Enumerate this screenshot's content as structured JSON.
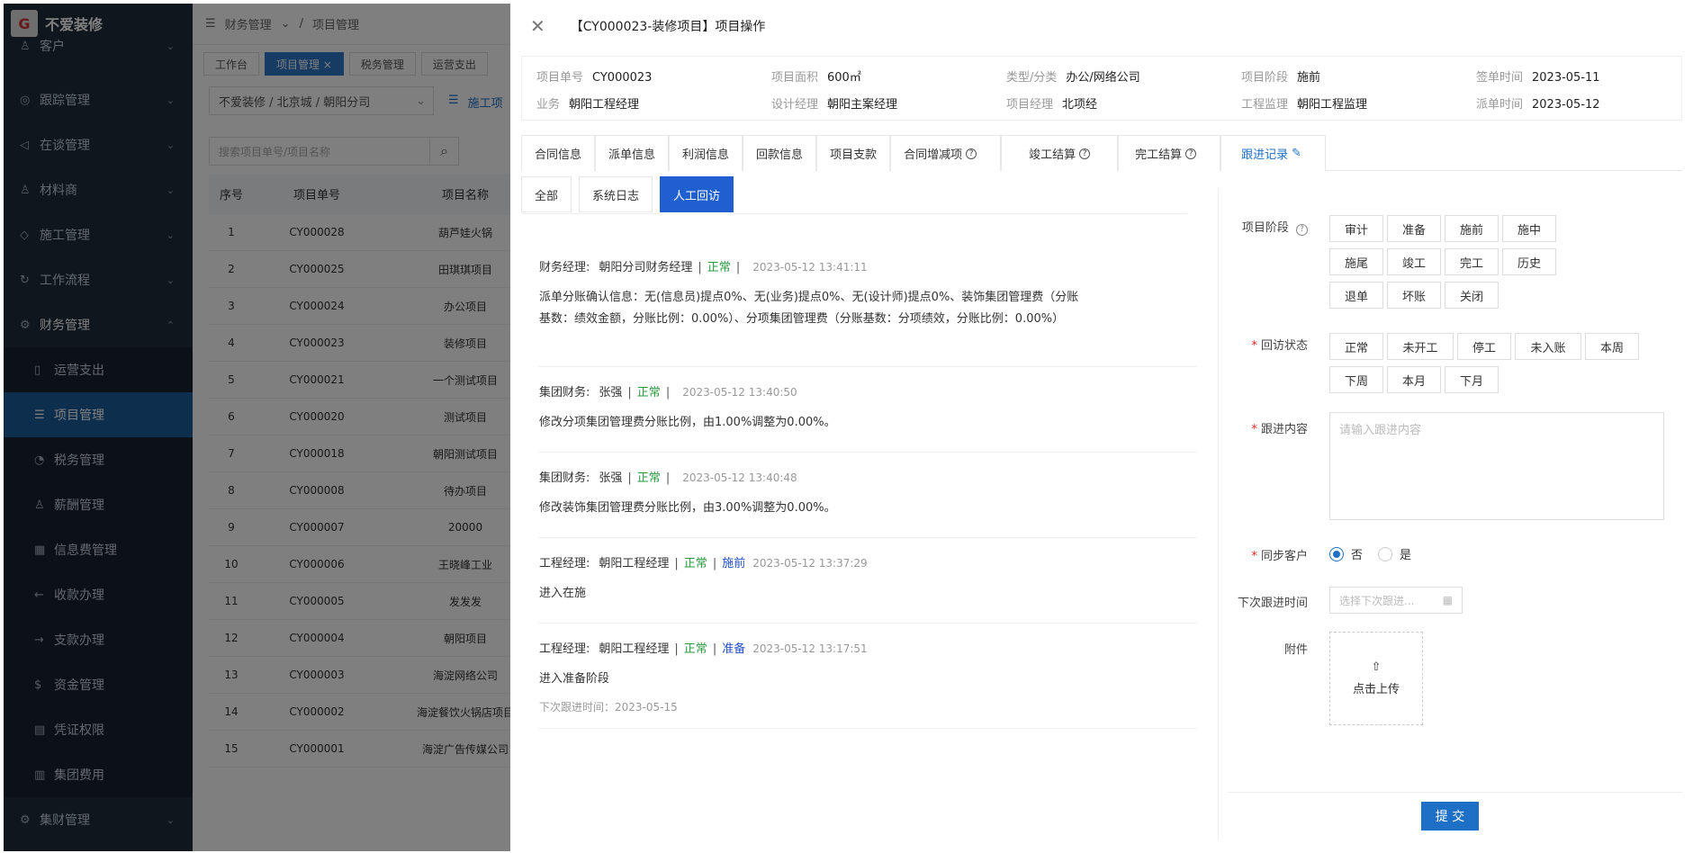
{
  "app": {
    "name": "不爱装修",
    "logo_text": "G"
  },
  "sidebar": {
    "items": [
      {
        "label": "客户",
        "icon": "user-icon",
        "glyph": "♙",
        "arrow": "⌄"
      },
      {
        "label": "跟踪管理",
        "icon": "target-icon",
        "glyph": "◎",
        "arrow": "⌄"
      },
      {
        "label": "在谈管理",
        "icon": "megaphone-icon",
        "glyph": "◁",
        "arrow": "⌄"
      },
      {
        "label": "材料商",
        "icon": "user-icon",
        "glyph": "♙",
        "arrow": "⌄"
      },
      {
        "label": "施工管理",
        "icon": "shield-icon",
        "glyph": "◇",
        "arrow": "⌄"
      },
      {
        "label": "工作流程",
        "icon": "refresh-icon",
        "glyph": "↻",
        "arrow": "⌄"
      },
      {
        "label": "财务管理",
        "icon": "gear-icon",
        "glyph": "⚙",
        "arrow": "⌃"
      }
    ],
    "sub_items": [
      {
        "label": "运营支出",
        "icon": "doc-icon",
        "glyph": "▯"
      },
      {
        "label": "项目管理",
        "icon": "list-icon",
        "glyph": "☰"
      },
      {
        "label": "税务管理",
        "icon": "pie-icon",
        "glyph": "◔"
      },
      {
        "label": "薪酬管理",
        "icon": "user-icon",
        "glyph": "♙"
      },
      {
        "label": "信息费管理",
        "icon": "calc-icon",
        "glyph": "▦"
      },
      {
        "label": "收款办理",
        "icon": "arrow-left-icon",
        "glyph": "←"
      },
      {
        "label": "支款办理",
        "icon": "arrow-right-icon",
        "glyph": "→"
      },
      {
        "label": "资金管理",
        "icon": "coin-icon",
        "glyph": "$"
      },
      {
        "label": "凭证权限",
        "icon": "voucher-icon",
        "glyph": "▤"
      },
      {
        "label": "集团费用",
        "icon": "grid-icon",
        "glyph": "▥"
      }
    ],
    "last_item": {
      "label": "集财管理",
      "icon": "gear-icon",
      "glyph": "⚙",
      "arrow": "⌄"
    }
  },
  "topbar": {
    "menu_glyph": "☰",
    "breadcrumb_1": "财务管理",
    "breadcrumb_2": "项目管理",
    "sep": "/",
    "chev": "⌄"
  },
  "tags": [
    {
      "label": "工作台"
    },
    {
      "label": "项目管理 ×"
    },
    {
      "label": "税务管理"
    },
    {
      "label": "运营支出"
    }
  ],
  "filter": {
    "value": "不爱装修 / 北京城 / 朝阳分司",
    "chev": "⌄",
    "list_glyph": "☰",
    "tab": "施工项"
  },
  "search": {
    "placeholder": "搜索项目单号/项目名称",
    "icon_glyph": "⌕"
  },
  "table": {
    "headers": [
      "序号",
      "项目单号",
      "项目名称"
    ],
    "rows": [
      [
        "1",
        "CY000028",
        "葫芦娃火锅"
      ],
      [
        "2",
        "CY000025",
        "田琪琪项目"
      ],
      [
        "3",
        "CY000024",
        "办公项目"
      ],
      [
        "4",
        "CY000023",
        "装修项目"
      ],
      [
        "5",
        "CY000021",
        "一个测试项目"
      ],
      [
        "6",
        "CY000020",
        "测试项目"
      ],
      [
        "7",
        "CY000018",
        "朝阳测试项目"
      ],
      [
        "8",
        "CY000008",
        "待办项目"
      ],
      [
        "9",
        "CY000007",
        "20000"
      ],
      [
        "10",
        "CY000006",
        "王晓峰工业"
      ],
      [
        "11",
        "CY000005",
        "发发发"
      ],
      [
        "12",
        "CY000004",
        "朝阳项目"
      ],
      [
        "13",
        "CY000003",
        "海淀网络公司"
      ],
      [
        "14",
        "CY000002",
        "海淀餐饮火锅店项目"
      ],
      [
        "15",
        "CY000001",
        "海淀广告传媒公司"
      ]
    ]
  },
  "drawer": {
    "close_glyph": "✕",
    "title": "【CY000023-装修项目】项目操作",
    "info": [
      {
        "k": "项目单号",
        "v": "CY000023"
      },
      {
        "k": "项目面积",
        "v": "600㎡"
      },
      {
        "k": "类型/分类",
        "v": "办公/网络公司"
      },
      {
        "k": "项目阶段",
        "v": "施前"
      },
      {
        "k": "签单时间",
        "v": "2023-05-11"
      },
      {
        "k": "业务",
        "v": "朝阳工程经理"
      },
      {
        "k": "设计经理",
        "v": "朝阳主案经理"
      },
      {
        "k": "项目经理",
        "v": "北项经"
      },
      {
        "k": "工程监理",
        "v": "朝阳工程监理"
      },
      {
        "k": "派单时间",
        "v": "2023-05-12"
      }
    ],
    "tabs": [
      {
        "label": "合同信息"
      },
      {
        "label": "派单信息"
      },
      {
        "label": "利润信息"
      },
      {
        "label": "回款信息"
      },
      {
        "label": "项目支款"
      },
      {
        "label": "合同增减项",
        "q": "?"
      },
      {
        "label": "竣工结算",
        "q": "?"
      },
      {
        "label": "完工结算",
        "q": "?"
      },
      {
        "label": "跟进记录",
        "edit": "✎"
      }
    ],
    "subtabs": [
      {
        "label": "全部"
      },
      {
        "label": "系统日志"
      },
      {
        "label": "人工回访"
      }
    ],
    "logs": [
      {
        "role": "财务经理:",
        "name": "朝阳分司财务经理",
        "status": "正常",
        "stage": "",
        "time": "2023-05-12 13:41:11",
        "body": "派单分账确认信息：无(信息员)提点0%、无(业务)提点0%、无(设计师)提点0%、装饰集团管理费（分账基数：绩效金额，分账比例：0.00%）、分项集团管理费（分账基数：分项绩效，分账比例：0.00%）",
        "next": ""
      },
      {
        "role": "集团财务:",
        "name": "张强",
        "status": "正常",
        "stage": "",
        "time": "2023-05-12 13:40:50",
        "body": "修改分项集团管理费分账比例，由1.00%调整为0.00%。",
        "next": ""
      },
      {
        "role": "集团财务:",
        "name": "张强",
        "status": "正常",
        "stage": "",
        "time": "2023-05-12 13:40:48",
        "body": "修改装饰集团管理费分账比例，由3.00%调整为0.00%。",
        "next": ""
      },
      {
        "role": "工程经理:",
        "name": "朝阳工程经理",
        "status": "正常",
        "stage": "施前",
        "time": "2023-05-12 13:37:29",
        "body": "进入在施",
        "next": ""
      },
      {
        "role": "工程经理:",
        "name": "朝阳工程经理",
        "status": "正常",
        "stage": "准备",
        "time": "2023-05-12 13:17:51",
        "body": "进入准备阶段",
        "next": "下次跟进时间：2023-05-15"
      }
    ],
    "form": {
      "stage_label": "项目阶段",
      "stage_help": "?",
      "stage_options": [
        "审计",
        "准备",
        "施前",
        "施中",
        "施尾",
        "竣工",
        "完工",
        "历史",
        "退单",
        "坏账",
        "关闭"
      ],
      "req": "*",
      "visit_label": "回访状态",
      "visit_options": [
        "正常",
        "未开工",
        "停工",
        "未入账",
        "本周",
        "下周",
        "本月",
        "下月"
      ],
      "content_label": "跟进内容",
      "content_placeholder": "请输入跟进内容",
      "sync_label": "同步客户",
      "sync_no": "否",
      "sync_yes": "是",
      "next_label": "下次跟进时间",
      "next_placeholder": "选择下次跟进...",
      "calendar_glyph": "▦",
      "attach_label": "附件",
      "upload_glyph": "⇧",
      "upload_text": "点击上传",
      "submit": "提 交"
    }
  },
  "colors": {
    "accent": "#1e6fc6",
    "ok": "#2a9a40",
    "stage": "#2451c6",
    "sidebar": "#1f2d3d"
  }
}
